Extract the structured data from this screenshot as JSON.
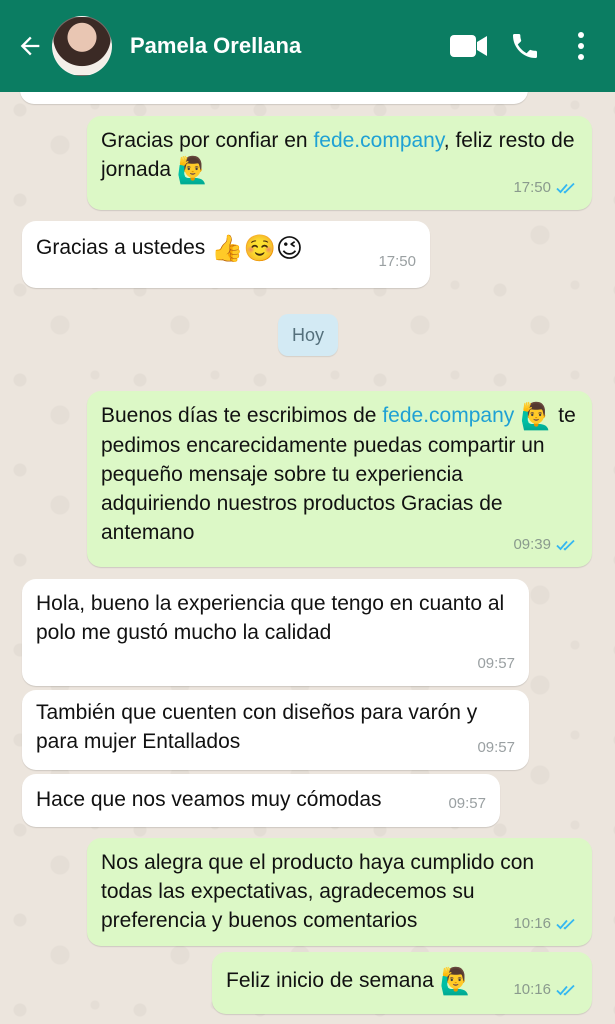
{
  "header": {
    "contact_name": "Pamela Orellana",
    "icons": [
      "back-arrow-icon",
      "avatar",
      "video-call-icon",
      "phone-icon",
      "more-options-icon"
    ],
    "color": "#0b7d62"
  },
  "day_separator": "Hoy",
  "messages": [
    {
      "part1": "Gracias por confiar en ",
      "link": "fede.company",
      "part2": ", feliz resto de jornada",
      "emoji": "🙋‍♂️",
      "time": "17:50"
    },
    {
      "text": "Gracias a ustedes",
      "emoji": "👍☺️😉",
      "time": "17:50"
    },
    {
      "part1": "Buenos días te escribimos de ",
      "link": "fede.company",
      "emoji": "🙋‍♂️",
      "part2": " te pedimos encarecidamente puedas compartir un pequeño mensaje sobre tu experiencia adquiriendo nuestros productos Gracias de antemano",
      "time": "09:39"
    },
    {
      "text": "Hola, bueno la experiencia que tengo en cuanto al polo me gustó mucho la calidad",
      "time": "09:57"
    },
    {
      "text": "También que cuenten con diseños para varón y para mujer Entallados",
      "time": "09:57"
    },
    {
      "text": "Hace que nos veamos muy cómodas",
      "time": "09:57"
    },
    {
      "text": "Nos alegra que el producto haya cumplido con todas las expectativas, agradecemos su preferencia y buenos comentarios",
      "time": "10:16"
    },
    {
      "text": "Feliz inicio de semana",
      "emoji": "🙋‍♂️",
      "time": "10:16"
    }
  ],
  "colors": {
    "outgoing": "#dcf8c6",
    "incoming": "#ffffff",
    "read_ticks": "#34b7f1",
    "link": "#1fa1d4"
  }
}
